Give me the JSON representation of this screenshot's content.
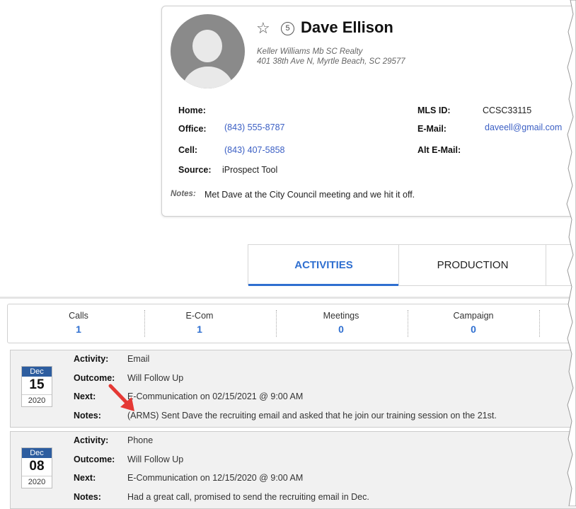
{
  "contact": {
    "name": "Dave Ellison",
    "rating": "5",
    "company": "Keller Williams Mb SC Realty",
    "address": "401 38th Ave N, Myrtle Beach, SC 29577",
    "fields_left": {
      "home_label": "Home:",
      "home_value": "",
      "office_label": "Office:",
      "office_value": "(843) 555-8787",
      "cell_label": "Cell:",
      "cell_value": "(843) 407-5858",
      "source_label": "Source:",
      "source_value": "iProspect Tool"
    },
    "fields_right": {
      "mls_label": "MLS ID:",
      "mls_value": "CCSC33115",
      "email_label": "E-Mail:",
      "email_value": "daveell@gmail.com",
      "alt_email_label": "Alt E-Mail:",
      "alt_email_value": ""
    },
    "notes_label": "Notes:",
    "notes_text": "Met Dave at the City Council meeting and we hit it off."
  },
  "tabs": [
    {
      "label": "ACTIVITIES",
      "active": true
    },
    {
      "label": "PRODUCTION",
      "active": false
    }
  ],
  "stats": [
    {
      "label": "Calls",
      "value": "1"
    },
    {
      "label": "E-Com",
      "value": "1"
    },
    {
      "label": "Meetings",
      "value": "0"
    },
    {
      "label": "Campaign",
      "value": "0"
    }
  ],
  "activities": [
    {
      "month": "Dec",
      "day": "15",
      "year": "2020",
      "activity_label": "Activity:",
      "activity": "Email",
      "outcome_label": "Outcome:",
      "outcome": "Will Follow Up",
      "next_label": "Next:",
      "next": "E-Communication on 02/15/2021 @ 9:00 AM",
      "notes_label": "Notes:",
      "notes": "(ARMS) Sent Dave the recruiting email and asked that he join our training session on the 21st."
    },
    {
      "month": "Dec",
      "day": "08",
      "year": "2020",
      "activity_label": "Activity:",
      "activity": "Phone",
      "outcome_label": "Outcome:",
      "outcome": "Will Follow Up",
      "next_label": "Next:",
      "next": "E-Communication on 12/15/2020 @ 9:00 AM",
      "notes_label": "Notes:",
      "notes": "Had a great call, promised to send the recruiting email in Dec."
    }
  ],
  "colors": {
    "accent": "#2f6fd0",
    "link": "#3b5fc4",
    "calendar_header": "#2d5d9f",
    "annotation_arrow": "#e53935"
  },
  "icons": {
    "star": "star-outline-icon",
    "avatar": "default-avatar-icon",
    "arrow": "red-annotation-arrow"
  }
}
